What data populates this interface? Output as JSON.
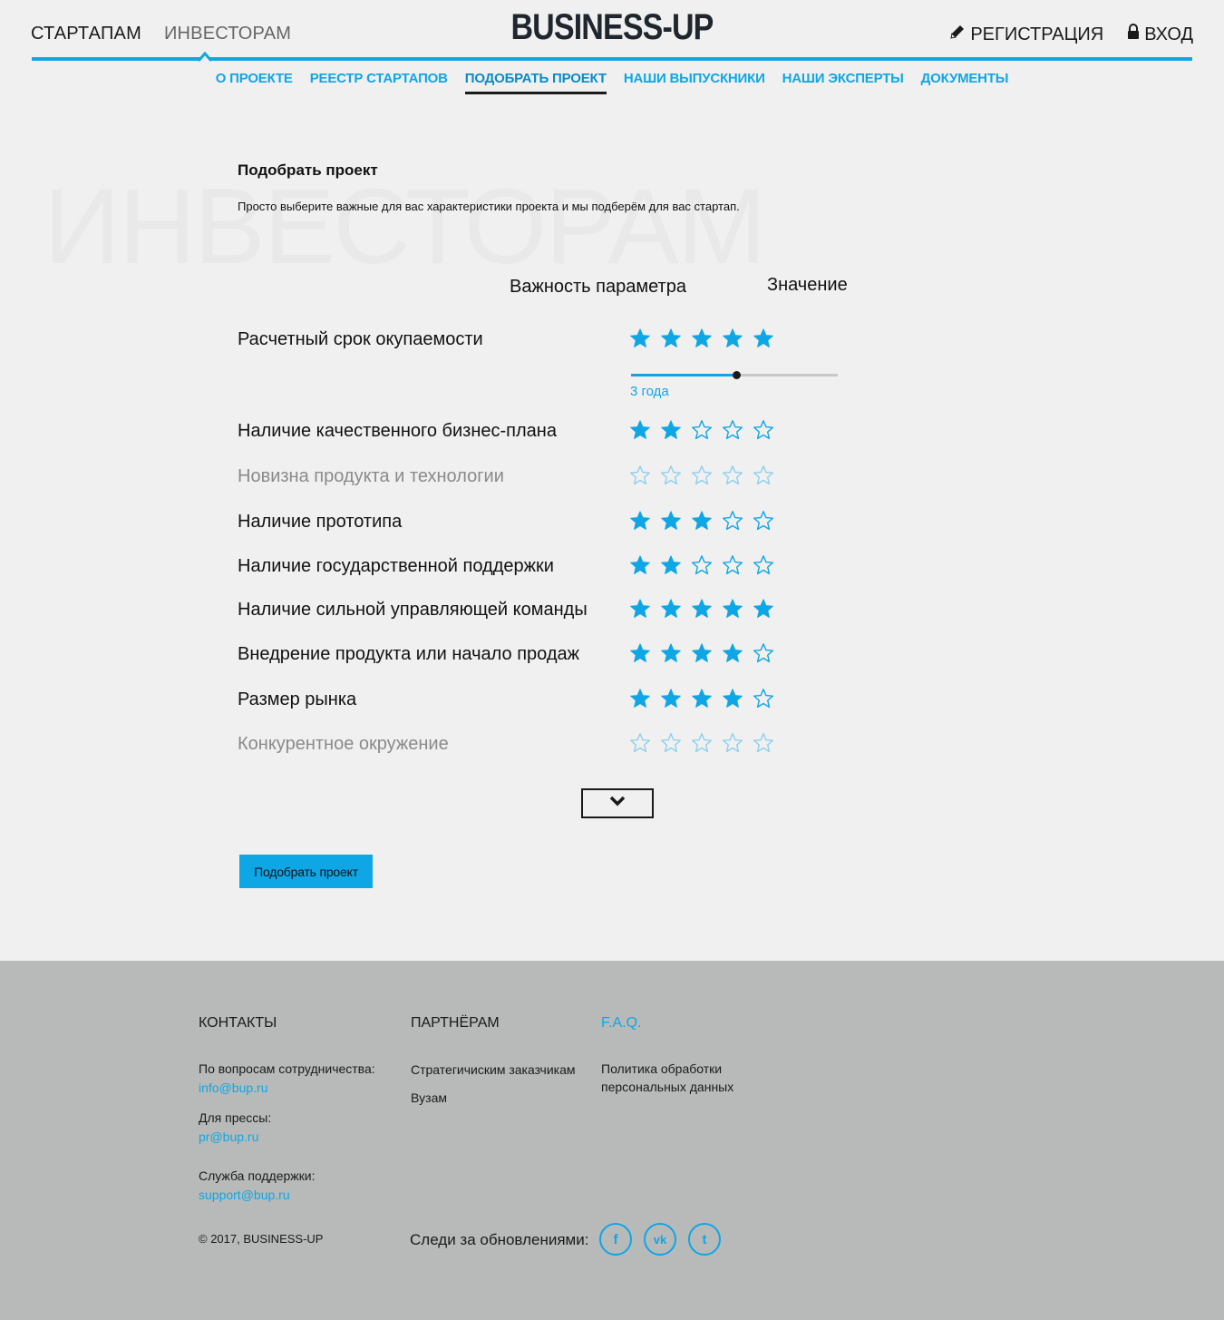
{
  "header": {
    "tabs": [
      {
        "label": "СТАРТАПАМ",
        "active": false
      },
      {
        "label": "ИНВЕСТОРАМ",
        "active": true
      }
    ],
    "logo": "BUSINESS-UP",
    "register_label": "РЕГИСТРАЦИЯ",
    "login_label": "ВХОД"
  },
  "subnav": {
    "items": [
      {
        "label": "О ПРОЕКТЕ"
      },
      {
        "label": "РЕЕСТР СТАРТАПОВ"
      },
      {
        "label": "ПОДОБРАТЬ ПРОЕКТ",
        "active": true
      },
      {
        "label": "НАШИ ВЫПУСКНИКИ"
      },
      {
        "label": "НАШИ ЭКСПЕРТЫ"
      },
      {
        "label": "ДОКУМЕНТЫ"
      }
    ]
  },
  "watermark": "ИНВЕСТОРАМ",
  "main": {
    "title": "Подобрать проект",
    "description": "Просто выберите важные для вас характеристики проекта и мы подберём для вас стартап.",
    "col_importance": "Важность параметра",
    "col_value": "Значение",
    "slider_value_label": "3 года",
    "slider_fraction": 0.51,
    "params": [
      {
        "label": "Расчетный срок окупаемости",
        "rating": 5,
        "disabled": false
      },
      {
        "label": "Наличие качественного бизнес-плана",
        "rating": 2,
        "disabled": false
      },
      {
        "label": "Новизна  продукта и технологии",
        "rating": 0,
        "disabled": true
      },
      {
        "label": "Наличие прототипа",
        "rating": 3,
        "disabled": false
      },
      {
        "label": "Наличие государственной поддержки",
        "rating": 2,
        "disabled": false
      },
      {
        "label": "Наличие сильной управляющей команды",
        "rating": 5,
        "disabled": false
      },
      {
        "label": "Внедрение продукта или начало продаж",
        "rating": 4,
        "disabled": false
      },
      {
        "label": "Размер рынка",
        "rating": 4,
        "disabled": false
      },
      {
        "label": "Конкурентное окружение",
        "rating": 0,
        "disabled": true
      }
    ],
    "submit_label": "Подобрать проект"
  },
  "footer": {
    "contacts_title": "КОНТАКТЫ",
    "coop_label": "По вопросам сотрудничества:",
    "coop_email": "info@bup.ru",
    "press_label": "Для прессы:",
    "press_email": "pr@bup.ru",
    "support_label": "Служба поддержки:",
    "support_email": "support@bup.ru",
    "copyright": "© 2017, BUSINESS-UP",
    "partners_title": "ПАРТНЁРАМ",
    "partner_link_1": "Стратегичиским заказчикам",
    "partner_link_2": "Вузам",
    "faq_title": "F.A.Q.",
    "policy_line1": "Политика обработки",
    "policy_line2": "персональных данных",
    "follow_label": "Следи за обновлениями:",
    "social": [
      {
        "icon": "facebook-icon",
        "glyph": "f"
      },
      {
        "icon": "vk-icon",
        "glyph": "vk"
      },
      {
        "icon": "twitter-icon",
        "glyph": "t"
      }
    ]
  },
  "colors": {
    "accent": "#0fa6e6",
    "background": "#f0f0f0",
    "footer_bg": "#b8bab9"
  }
}
